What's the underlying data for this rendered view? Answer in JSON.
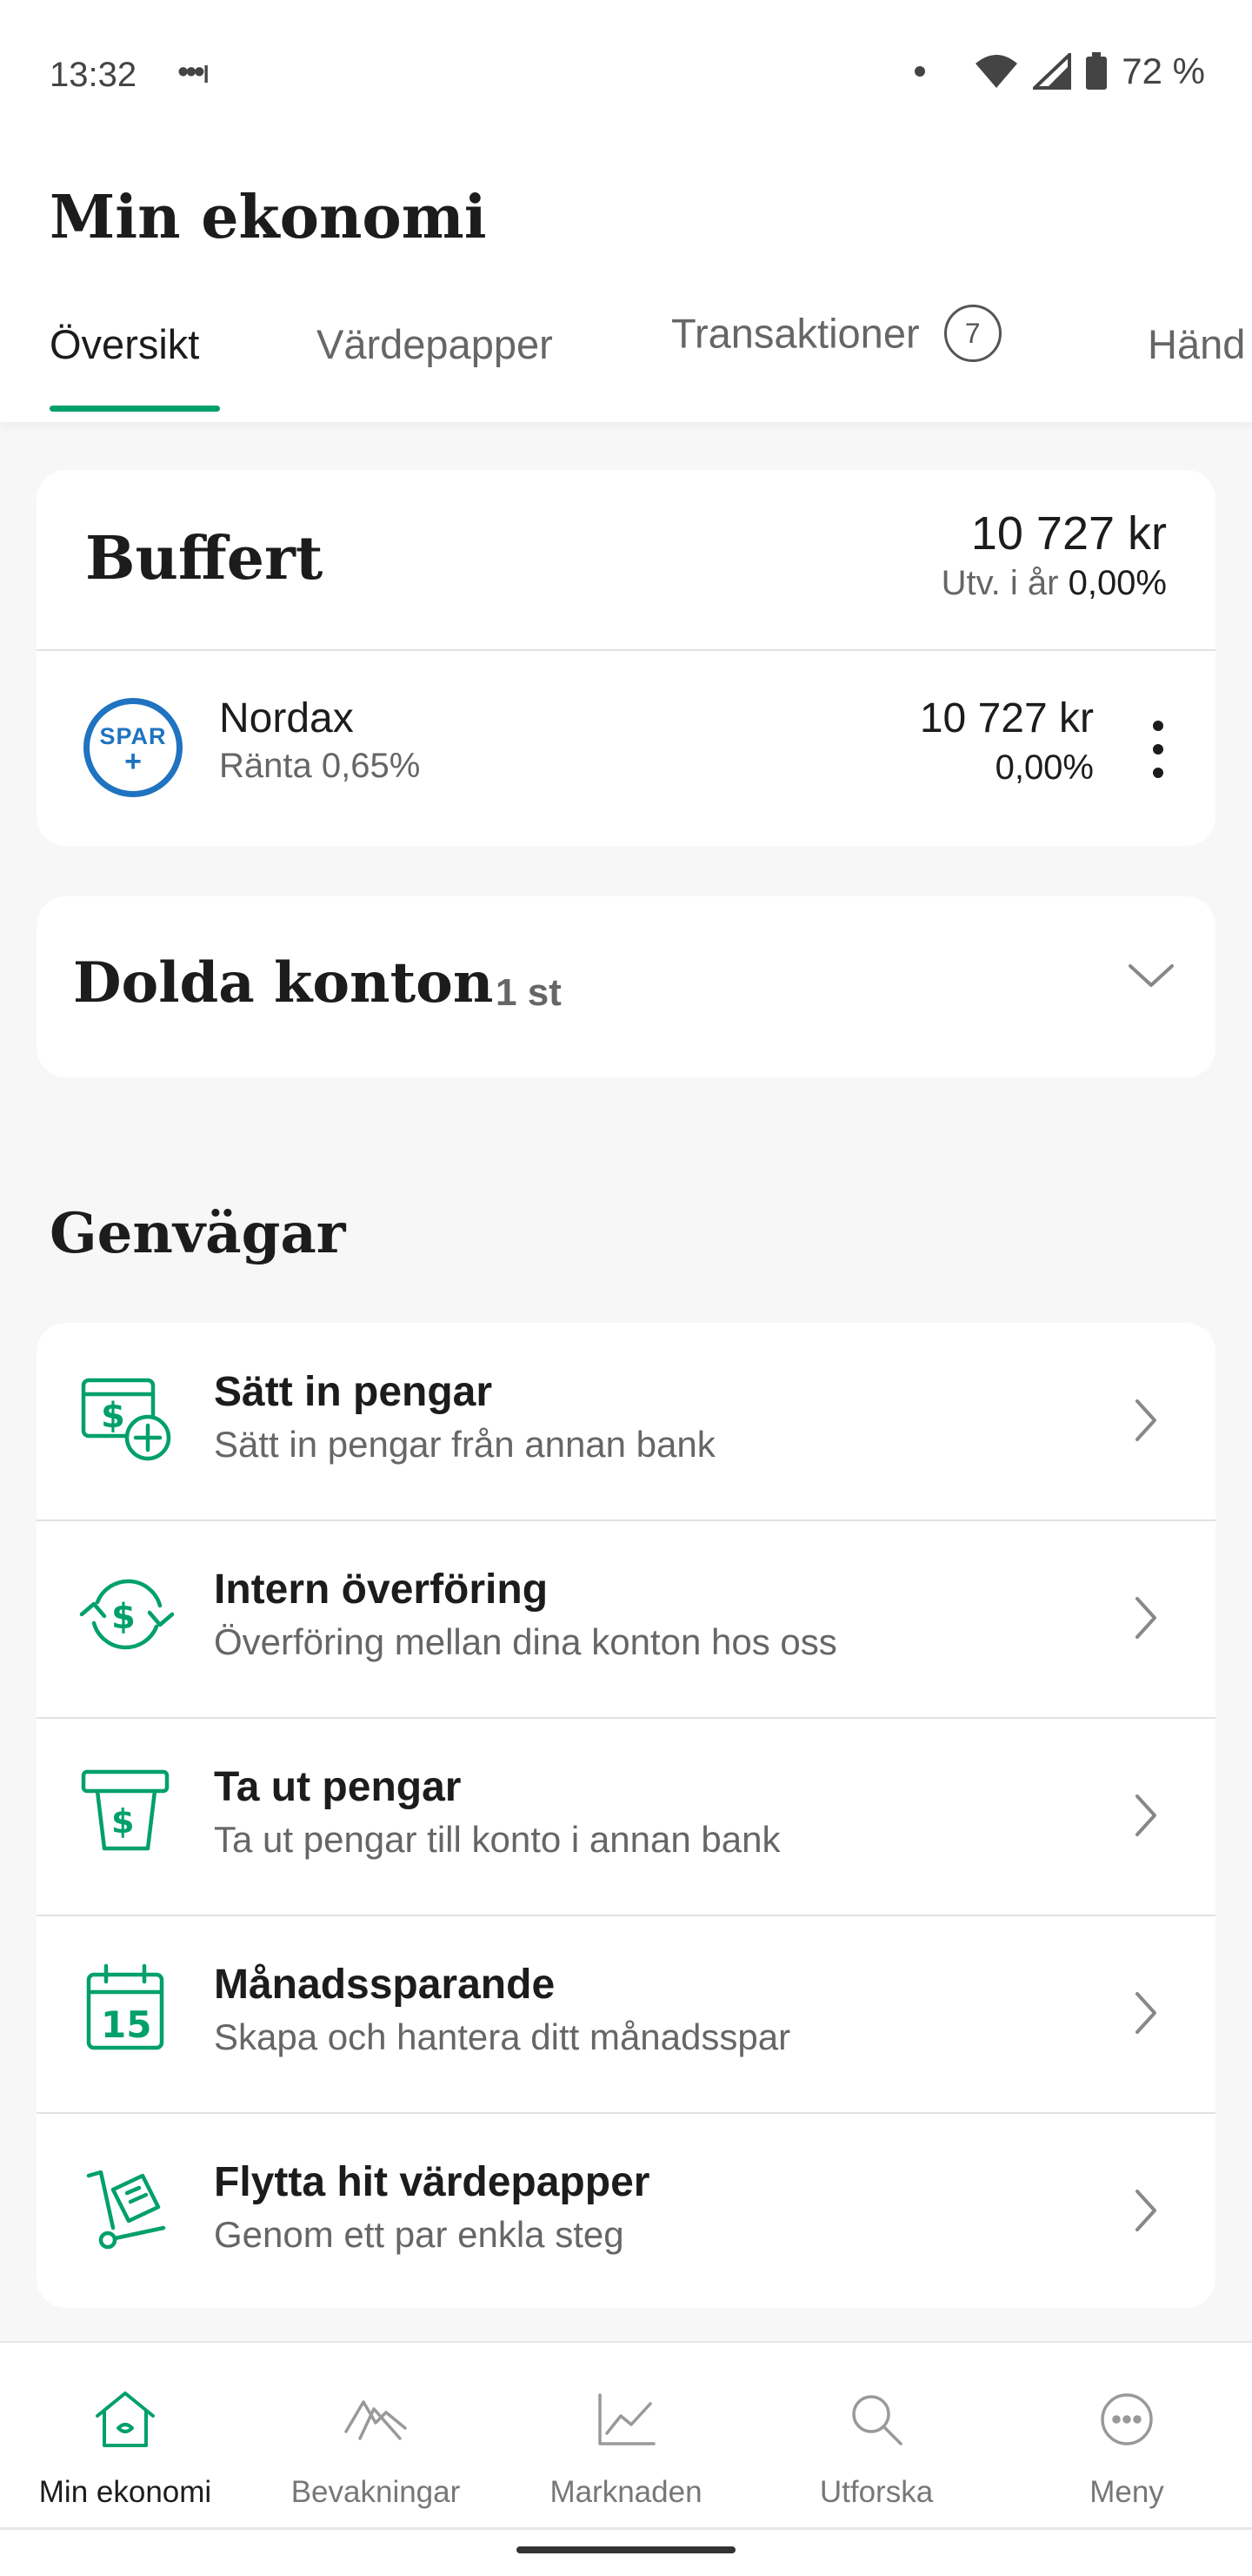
{
  "status_bar": {
    "time": "13:32",
    "signal_dots": "•••ı",
    "battery": "72 %"
  },
  "header": {
    "title": "Min ekonomi",
    "tabs": [
      {
        "label": "Översikt",
        "active": true
      },
      {
        "label": "Värdepapper"
      },
      {
        "label": "Transaktioner",
        "badge": "7"
      },
      {
        "label": "Händ"
      }
    ]
  },
  "buffert": {
    "title": "Buffert",
    "amount": "10 727 kr",
    "growth_label": "Utv. i år",
    "growth_value": "0,00%",
    "account": {
      "logo_top": "SPAR",
      "logo_bottom": "+",
      "name": "Nordax",
      "rate": "Ränta 0,65%",
      "amount": "10 727 kr",
      "percent": "0,00%"
    }
  },
  "hidden_accounts": {
    "title": "Dolda konton",
    "count": "1 st"
  },
  "shortcuts": {
    "title": "Genvägar",
    "items": [
      {
        "icon": "deposit-icon",
        "title": "Sätt in pengar",
        "subtitle": "Sätt in pengar från annan bank"
      },
      {
        "icon": "transfer-icon",
        "title": "Intern överföring",
        "subtitle": "Överföring mellan dina konton hos oss"
      },
      {
        "icon": "withdraw-icon",
        "title": "Ta ut pengar",
        "subtitle": "Ta ut pengar till konto i annan bank"
      },
      {
        "icon": "calendar-icon",
        "title": "Månadssparande",
        "subtitle": "Skapa och hantera ditt månadsspar"
      },
      {
        "icon": "move-securities-icon",
        "title": "Flytta hit värdepapper",
        "subtitle": "Genom ett par enkla steg"
      }
    ]
  },
  "bottom_nav": {
    "items": [
      {
        "label": "Min ekonomi",
        "icon": "home-icon",
        "active": true
      },
      {
        "label": "Bevakningar",
        "icon": "watch-icon"
      },
      {
        "label": "Marknaden",
        "icon": "chart-icon"
      },
      {
        "label": "Utforska",
        "icon": "search-icon"
      },
      {
        "label": "Meny",
        "icon": "menu-icon"
      }
    ]
  },
  "colors": {
    "accent": "#00a06b",
    "spar_blue": "#1f73c0",
    "background": "#f7f7f7"
  }
}
